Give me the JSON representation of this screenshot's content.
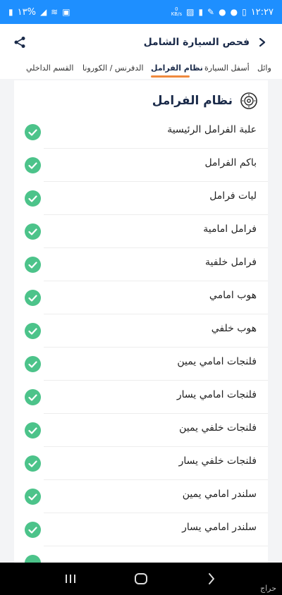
{
  "status_bar": {
    "time": "١٢:٢٧",
    "battery": "١٣%",
    "net_speed_label": "KB/s",
    "net_speed_value": "0"
  },
  "header": {
    "title": "فحص السيارة الشامل"
  },
  "tabs": [
    {
      "label": "وائل"
    },
    {
      "label": "أسفل السيارة"
    },
    {
      "label": "نظام الفرامل",
      "active": true
    },
    {
      "label": "الدفرنس / الكورونا"
    },
    {
      "label": "القسم الداخلي"
    }
  ],
  "section": {
    "title": "نظام الفرامل"
  },
  "items": [
    {
      "label": "علبة الفرامل الرئيسية",
      "status": "ok"
    },
    {
      "label": "باكم الفرامل",
      "status": "ok"
    },
    {
      "label": "ليات فرامل",
      "status": "ok"
    },
    {
      "label": "فرامل امامية",
      "status": "ok"
    },
    {
      "label": "فرامل خلفية",
      "status": "ok"
    },
    {
      "label": "هوب امامي",
      "status": "ok"
    },
    {
      "label": "هوب خلفي",
      "status": "ok"
    },
    {
      "label": "فلنجات امامي يمين",
      "status": "ok"
    },
    {
      "label": "فلنجات امامي يسار",
      "status": "ok"
    },
    {
      "label": "فلنجات خلفي يمين",
      "status": "ok"
    },
    {
      "label": "فلنجات خلفي يسار",
      "status": "ok"
    },
    {
      "label": "سلندر امامي يمين",
      "status": "ok"
    },
    {
      "label": "سلندر امامي يسار",
      "status": "ok"
    }
  ],
  "colors": {
    "accent_blue": "#1e8fff",
    "check_green": "#4cc38a",
    "tab_underline": "#f08a3e",
    "title_navy": "#1b2b4a"
  },
  "watermark": "حراج"
}
